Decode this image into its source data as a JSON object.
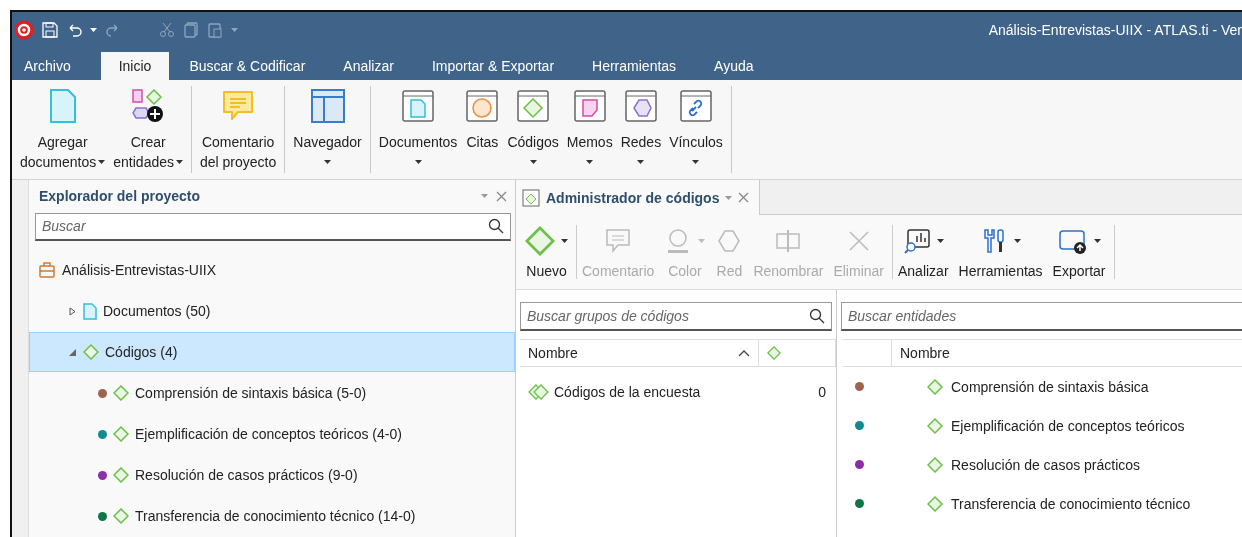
{
  "window": {
    "title": "Análisis-Entrevistas-UIIX - ATLAS.ti - Ver"
  },
  "menu_tabs": [
    {
      "label": "Archivo",
      "selected": false
    },
    {
      "label": "Inicio",
      "selected": true
    },
    {
      "label": "Buscar & Codificar",
      "selected": false
    },
    {
      "label": "Analizar",
      "selected": false
    },
    {
      "label": "Importar & Exportar",
      "selected": false
    },
    {
      "label": "Herramientas",
      "selected": false
    },
    {
      "label": "Ayuda",
      "selected": false
    }
  ],
  "ribbon_groups": [
    [
      {
        "kind": "add-document",
        "lines": [
          "Agregar",
          "documentos"
        ],
        "dropdown": true
      },
      {
        "kind": "create-entities",
        "lines": [
          "Crear",
          "entidades"
        ],
        "dropdown": true
      }
    ],
    [
      {
        "kind": "comment",
        "lines": [
          "Comentario",
          "del proyecto"
        ],
        "dropdown": false
      }
    ],
    [
      {
        "kind": "navigator",
        "lines": [
          "Navegador"
        ],
        "dropdown": true
      }
    ],
    [
      {
        "kind": "documents",
        "lines": [
          "Documentos"
        ],
        "dropdown": true
      },
      {
        "kind": "quotes",
        "lines": [
          "Citas"
        ],
        "dropdown": false
      },
      {
        "kind": "codes",
        "lines": [
          "Códigos"
        ],
        "dropdown": true
      },
      {
        "kind": "memos",
        "lines": [
          "Memos"
        ],
        "dropdown": true
      },
      {
        "kind": "networks",
        "lines": [
          "Redes"
        ],
        "dropdown": true
      },
      {
        "kind": "links",
        "lines": [
          "Vínculos"
        ],
        "dropdown": true
      }
    ]
  ],
  "explorer": {
    "title": "Explorador del proyecto",
    "search": {
      "placeholder": "Buscar"
    },
    "tree": [
      {
        "kind": "project",
        "label": "Análisis-Entrevistas-UIIX",
        "selected": false,
        "children": [
          {
            "kind": "documents",
            "label": "Documentos (50)",
            "expanded": false,
            "selected": false
          },
          {
            "kind": "codes",
            "label": "Códigos (4)",
            "expanded": true,
            "selected": true,
            "children": [
              {
                "kind": "code",
                "label": "Comprensión de sintaxis básica (5-0)",
                "color": "#9b6450",
                "selected": false
              },
              {
                "kind": "code",
                "label": "Ejemplificación de conceptos teóricos (4-0)",
                "color": "#128a92",
                "selected": false
              },
              {
                "kind": "code",
                "label": "Resolución de casos prácticos (9-0)",
                "color": "#8a2fa6",
                "selected": false
              },
              {
                "kind": "code",
                "label": "Transferencia de conocimiento técnico (14-0)",
                "color": "#0f7548",
                "selected": false
              }
            ]
          }
        ]
      }
    ]
  },
  "code_manager": {
    "tab_title": "Administrador de códigos",
    "toolbar": [
      {
        "kind": "new",
        "label": "Nuevo",
        "dropdown": true,
        "disabled": false,
        "separator_after": true
      },
      {
        "kind": "comment",
        "label": "Comentario",
        "dropdown": false,
        "disabled": true,
        "separator_after": false
      },
      {
        "kind": "color",
        "label": "Color",
        "dropdown": true,
        "disabled": true,
        "separator_after": false
      },
      {
        "kind": "network",
        "label": "Red",
        "dropdown": false,
        "disabled": true,
        "separator_after": false
      },
      {
        "kind": "rename",
        "label": "Renombrar",
        "dropdown": false,
        "disabled": true,
        "separator_after": false
      },
      {
        "kind": "delete",
        "label": "Eliminar",
        "dropdown": false,
        "disabled": true,
        "separator_after": true
      },
      {
        "kind": "analyze",
        "label": "Analizar",
        "dropdown": true,
        "disabled": false,
        "separator_after": false
      },
      {
        "kind": "tools",
        "label": "Herramientas",
        "dropdown": true,
        "disabled": false,
        "separator_after": false
      },
      {
        "kind": "export",
        "label": "Exportar",
        "dropdown": true,
        "disabled": false,
        "separator_after": true
      }
    ],
    "groups_pane": {
      "search": {
        "placeholder": "Buscar grupos de códigos"
      },
      "column": "Nombre",
      "rows": [
        {
          "name": "Códigos de la encuesta",
          "count": "0"
        }
      ]
    },
    "entities_pane": {
      "search": {
        "placeholder": "Buscar entidades"
      },
      "column": "Nombre",
      "rows": [
        {
          "name": "Comprensión de sintaxis básica",
          "color": "#9b6450"
        },
        {
          "name": "Ejemplificación de conceptos teóricos",
          "color": "#128a92"
        },
        {
          "name": "Resolución de casos prácticos",
          "color": "#8a2fa6"
        },
        {
          "name": "Transferencia de conocimiento técnico",
          "color": "#0f7548"
        }
      ]
    }
  }
}
